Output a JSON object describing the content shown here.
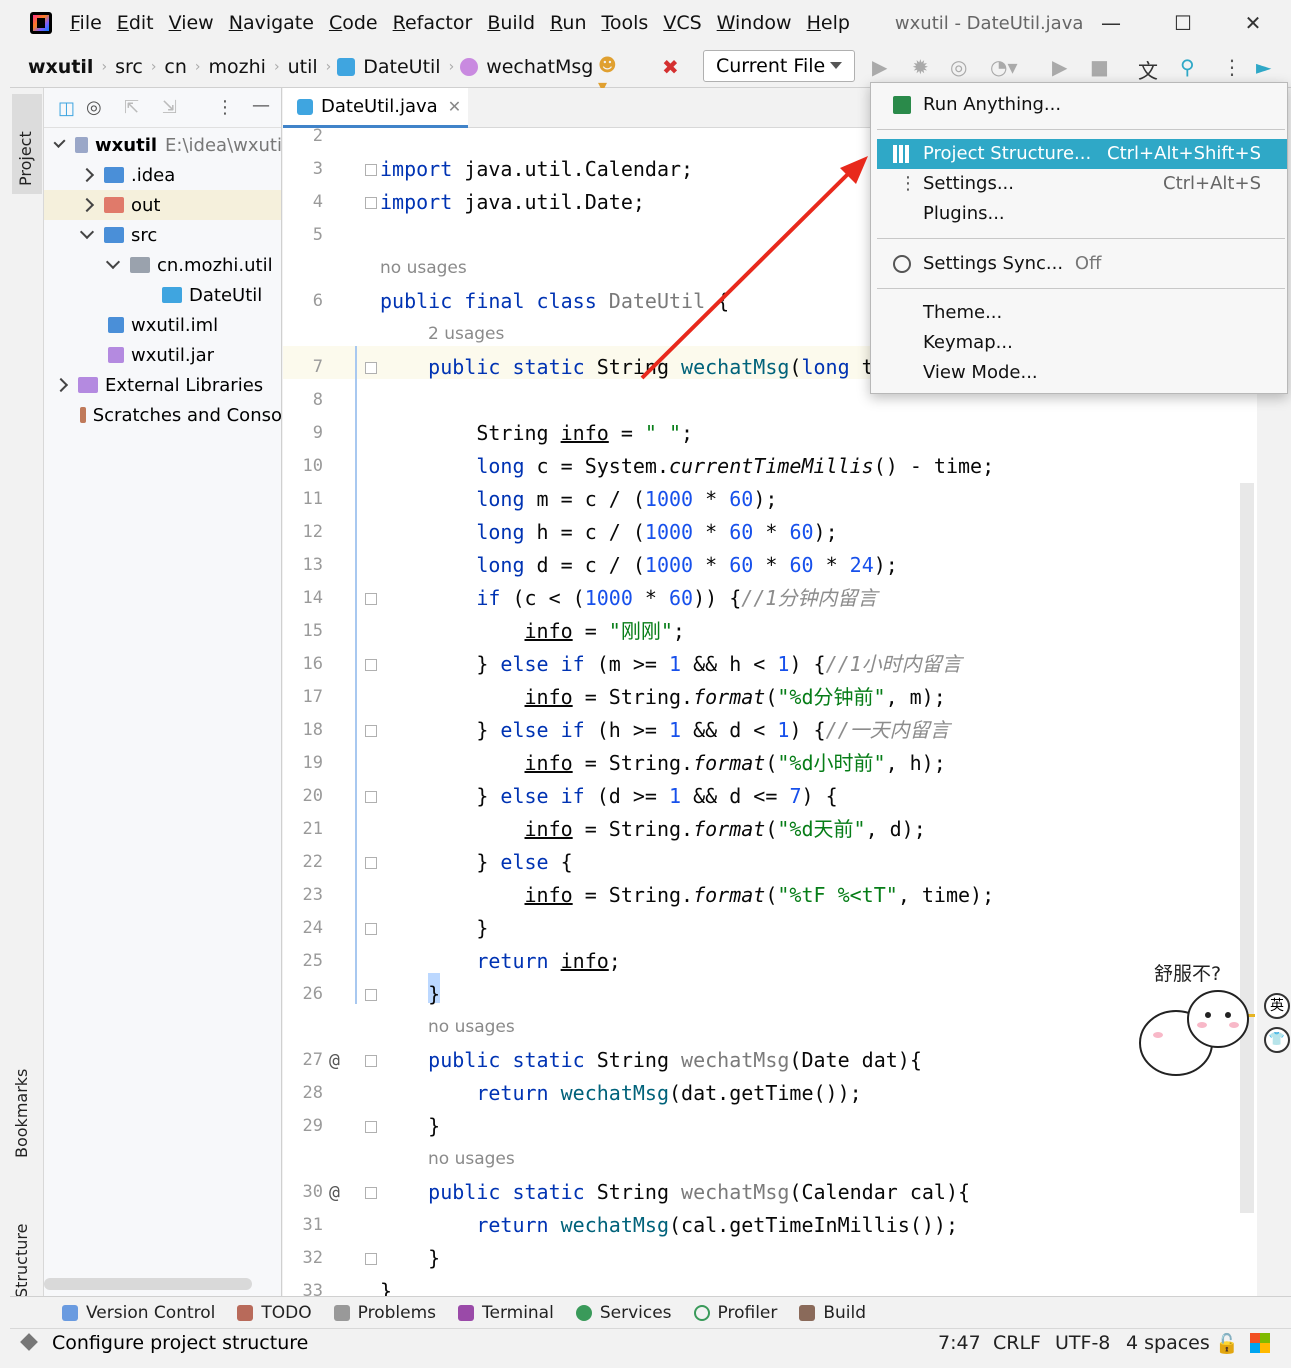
{
  "menu": {
    "items": [
      "File",
      "Edit",
      "View",
      "Navigate",
      "Code",
      "Refactor",
      "Build",
      "Run",
      "Tools",
      "VCS",
      "Window",
      "Help"
    ],
    "window_title": "wxutil - DateUtil.java"
  },
  "breadcrumb": {
    "project": "wxutil",
    "parts": [
      "src",
      "cn",
      "mozhi",
      "util",
      "DateUtil",
      "wechatMsg"
    ]
  },
  "run_config": {
    "selected": "Current File"
  },
  "side_tabs": {
    "project": "Project",
    "bookmarks": "Bookmarks",
    "structure": "Structure"
  },
  "project_tree": {
    "root": {
      "name": "wxutil",
      "path": "E:\\idea\\wxuti"
    },
    "items": [
      {
        "label": ".idea"
      },
      {
        "label": "out"
      },
      {
        "label": "src"
      },
      {
        "label": "cn.mozhi.util"
      },
      {
        "label": "DateUtil"
      },
      {
        "label": "wxutil.iml"
      },
      {
        "label": "wxutil.jar"
      },
      {
        "label": "External Libraries"
      },
      {
        "label": "Scratches and Conso"
      }
    ]
  },
  "editor": {
    "tab_label": "DateUtil.java",
    "line_numbers": [
      "2",
      "3",
      "4",
      "5",
      "6",
      "7",
      "8",
      "9",
      "10",
      "11",
      "12",
      "13",
      "14",
      "15",
      "16",
      "17",
      "18",
      "19",
      "20",
      "21",
      "22",
      "23",
      "24",
      "25",
      "26",
      "27",
      "28",
      "29",
      "30",
      "31",
      "32",
      "33"
    ],
    "hints": {
      "no_usages": "no usages",
      "two_usages": "2 usages"
    }
  },
  "popup_menu": {
    "items": [
      {
        "label": "Run Anything...",
        "shortcut": ""
      },
      {
        "label": "Project Structure...",
        "shortcut": "Ctrl+Alt+Shift+S"
      },
      {
        "label": "Settings...",
        "shortcut": "Ctrl+Alt+S"
      },
      {
        "label": "Plugins...",
        "shortcut": ""
      },
      {
        "label": "Settings Sync...",
        "shortcut": "Off"
      },
      {
        "label": "Theme...",
        "shortcut": ""
      },
      {
        "label": "Keymap...",
        "shortcut": ""
      },
      {
        "label": "View Mode...",
        "shortcut": ""
      }
    ]
  },
  "bottom_tabs": [
    "Version Control",
    "TODO",
    "Problems",
    "Terminal",
    "Services",
    "Profiler",
    "Build"
  ],
  "status": {
    "message": "Configure project structure",
    "position": "7:47",
    "line_sep": "CRLF",
    "encoding": "UTF-8",
    "indent": "4 spaces"
  },
  "sticker": {
    "text": "舒服不?",
    "side_labels": [
      "英",
      "👕"
    ]
  },
  "colors": {
    "accent": "#2fa8c7",
    "keyword": "#0033b3",
    "number": "#1750eb",
    "string": "#067d17",
    "arrow": "#e8291c"
  }
}
